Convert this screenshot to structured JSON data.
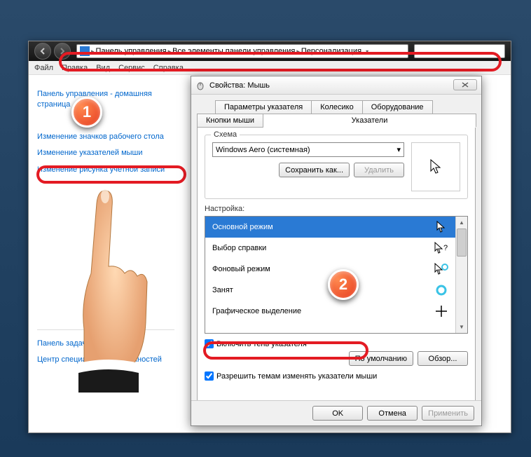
{
  "breadcrumb": {
    "items": [
      "Панель управления",
      "Все элементы панели управления",
      "Персонализация"
    ]
  },
  "menubar": {
    "items": [
      "Файл",
      "Правка",
      "Вид",
      "Сервис",
      "Справка"
    ]
  },
  "sidebar": {
    "items": [
      "Панель управления - домашняя страница",
      "Изменение значков рабочего стола",
      "Изменение указателей мыши",
      "Изменение рисунка учетной записи"
    ],
    "footer_items": [
      "Панель задач и меню \"Пуск\"",
      "Центр специальных возможностей"
    ]
  },
  "dialog": {
    "title": "Свойства: Мышь",
    "tabs_row1": [
      "Параметры указателя",
      "Колесико",
      "Оборудование"
    ],
    "tabs_row2": [
      "Кнопки мыши",
      "Указатели"
    ],
    "active_tab": "Указатели",
    "scheme": {
      "group_label": "Схема",
      "value": "Windows Aero (системная)",
      "save_as": "Сохранить как...",
      "delete": "Удалить"
    },
    "settings_label": "Настройка:",
    "cursors": [
      {
        "label": "Основной режим",
        "glyph": "arrow",
        "selected": true
      },
      {
        "label": "Выбор справки",
        "glyph": "help",
        "selected": false
      },
      {
        "label": "Фоновый режим",
        "glyph": "busy-bg",
        "selected": false
      },
      {
        "label": "Занят",
        "glyph": "busy",
        "selected": false
      },
      {
        "label": "Графическое выделение",
        "glyph": "cross",
        "selected": false
      }
    ],
    "enable_shadow": "Включить тень указателя",
    "allow_themes": "Разрешить темам изменять указатели мыши",
    "defaults_btn": "По умолчанию",
    "browse_btn": "Обзор...",
    "footer": {
      "ok": "OK",
      "cancel": "Отмена",
      "apply": "Применить"
    }
  },
  "callouts": {
    "one": "1",
    "two": "2"
  }
}
